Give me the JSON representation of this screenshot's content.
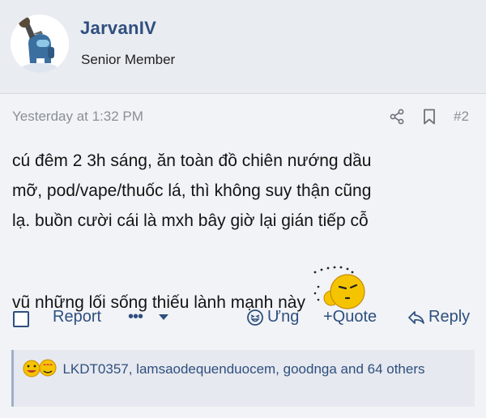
{
  "user": {
    "name": "JarvanIV",
    "title": "Senior Member"
  },
  "post": {
    "date": "Yesterday at 1:32 PM",
    "number": "#2",
    "lines": [
      "cú đêm 2 3h sáng, ăn toàn đồ chiên nướng dầu",
      "mỡ, pod/vape/thuốc lá, thì không suy thận cũng",
      "lạ. buồn cười cái là mxh bây giờ lại gián tiếp cỗ",
      "vũ những lối sống thiếu lành mạnh này"
    ]
  },
  "actions": {
    "report": "Report",
    "more": "•••",
    "react": "Ưng",
    "quote": "+Quote",
    "reply": "Reply"
  },
  "reactions": {
    "text": "LKDT0357, lamsaodequenduocem, goodnga and 64 others"
  },
  "colors": {
    "accent": "#2f4f7f",
    "meta": "#8a8f98",
    "emoji_yellow": "#f5c400"
  },
  "icons": [
    "share-icon",
    "bookmark-icon",
    "laugh-react-icon",
    "reply-arrow-icon",
    "emoji-sleepy"
  ]
}
